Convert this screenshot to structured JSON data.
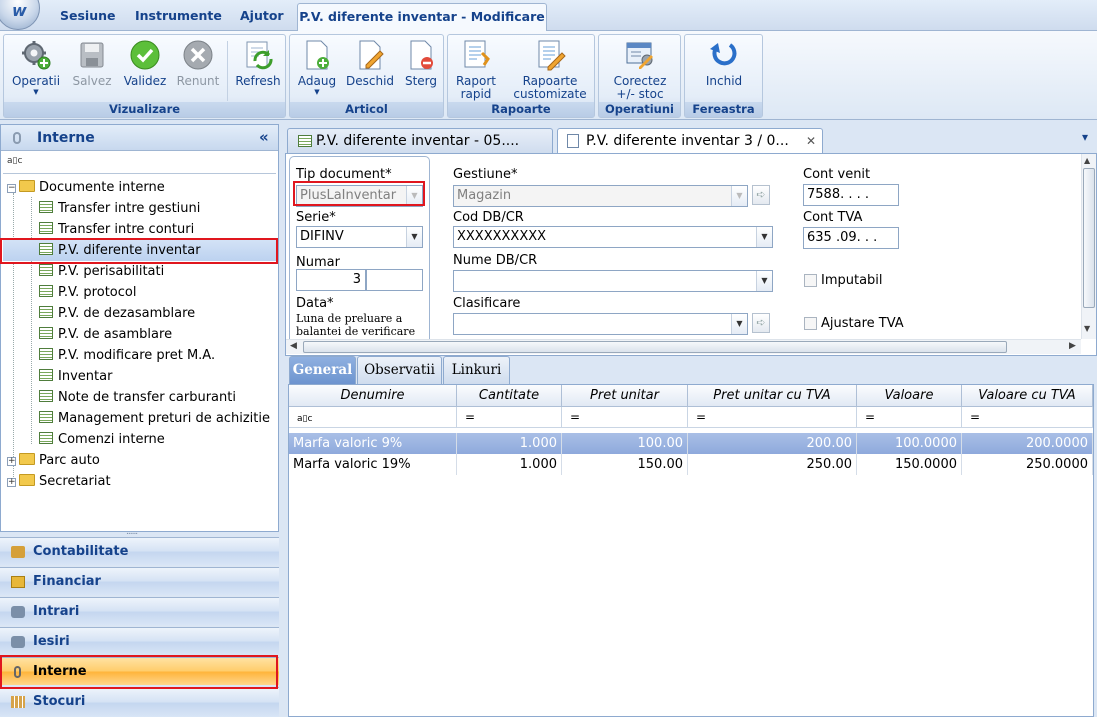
{
  "app": {
    "menu": [
      "Sesiune",
      "Instrumente",
      "Ajutor"
    ],
    "active_tab": "P.V. diferente inventar -  Modificare"
  },
  "ribbon": {
    "vizualizare": {
      "label": "Vizualizare",
      "buttons": [
        "Operatii",
        "Salvez",
        "Validez",
        "Renunt",
        "Refresh"
      ]
    },
    "articol": {
      "label": "Articol",
      "buttons": [
        "Adaug",
        "Deschid",
        "Sterg"
      ]
    },
    "rapoarte": {
      "label": "Rapoarte",
      "raport_line1": "Raport",
      "raport_line2": "rapid",
      "custom_line1": "Rapoarte",
      "custom_line2": "customizate"
    },
    "operatiuni": {
      "label": "Operatiuni",
      "line1": "Corectez",
      "line2": "+/- stoc"
    },
    "fereastra": {
      "label": "Fereastra",
      "button": "Inchid"
    }
  },
  "left_panel": {
    "title": "Interne",
    "collapse": "«",
    "filter_icon": "a▯c",
    "tree": {
      "root": "Documente interne",
      "items": [
        "Transfer intre gestiuni",
        "Transfer intre conturi",
        "P.V. diferente inventar",
        "P.V. perisabilitati",
        "P.V. protocol",
        "P.V. de dezasamblare",
        "P.V. de asamblare",
        "P.V. modificare pret M.A.",
        "Inventar",
        "Note de transfer carburanti",
        "Management preturi de achizitie",
        "Comenzi interne"
      ],
      "others": [
        "Parc auto",
        "Secretariat"
      ]
    },
    "splitter": "......",
    "nav": [
      "Contabilitate",
      "Financiar",
      "Intrari",
      "Iesiri",
      "Interne",
      "Stocuri"
    ]
  },
  "doc_tabs": {
    "tab1": "P.V. diferente inventar - 05....",
    "tab2": "P.V. diferente inventar 3 / 0...",
    "close": "✕",
    "menu": "▾"
  },
  "form": {
    "tip_document_label": "Tip document*",
    "tip_document_value": "PlusLaInventar",
    "serie_label": "Serie*",
    "serie_value": "DIFINV",
    "numar_label": "Numar",
    "numar_value": "3",
    "data_label": "Data*",
    "data_note": "Luna de preluare a balantei de verificare",
    "gestiune_label": "Gestiune*",
    "gestiune_value": "Magazin",
    "cod_label": "Cod DB/CR",
    "cod_value": "XXXXXXXXXX",
    "nume_label": "Nume DB/CR",
    "nume_value": "",
    "clasificare_label": "Clasificare",
    "clasificare_value": "",
    "cont_venit_label": "Cont venit",
    "cont_venit_value": "7588.  .  .  .",
    "cont_tva_label": "Cont TVA",
    "cont_tva_value": "635 .09.  .  .",
    "imputabil_label": "Imputabil",
    "ajustare_label": "Ajustare TVA"
  },
  "sub_tabs": [
    "General",
    "Observatii",
    "Linkuri"
  ],
  "grid": {
    "columns": [
      "Denumire",
      "Cantitate",
      "Pret unitar",
      "Pret unitar cu TVA",
      "Valoare",
      "Valoare cu TVA"
    ],
    "filter_icon": "a▯c",
    "filter_eq": "=",
    "rows": [
      [
        "Marfa valoric 9%",
        "1.000",
        "100.00",
        "200.00",
        "100.0000",
        "200.0000"
      ],
      [
        "Marfa valoric 19%",
        "1.000",
        "150.00",
        "250.00",
        "150.0000",
        "250.0000"
      ]
    ]
  }
}
